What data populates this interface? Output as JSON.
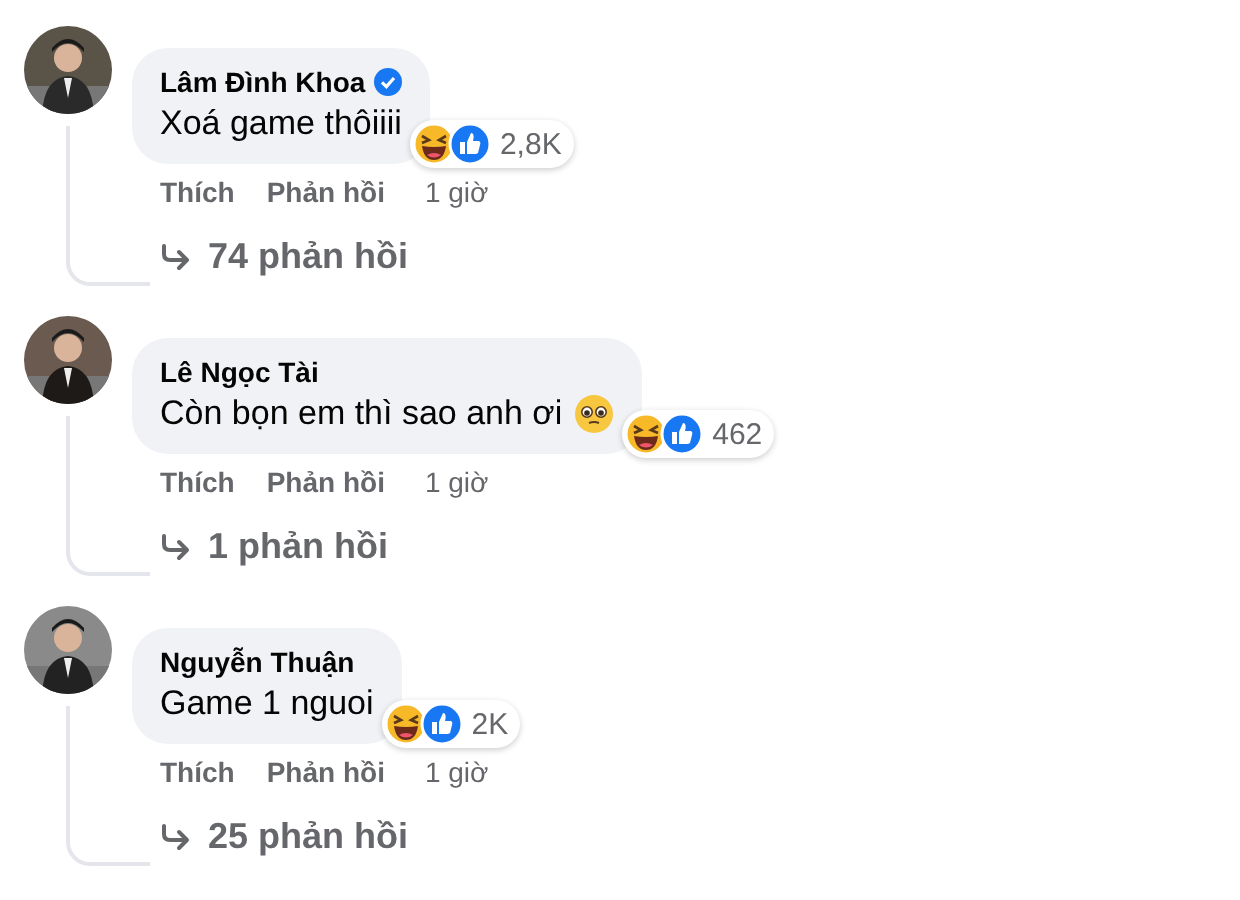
{
  "comments": [
    {
      "author": "Lâm Đình Khoa",
      "verified": true,
      "text": "Xoá game thôiiii",
      "has_emoji": false,
      "reaction_count": "2,8K",
      "actions": [
        "Thích",
        "Phản hồi"
      ],
      "time": "1 giờ",
      "replies": "74 phản hồi"
    },
    {
      "author": "Lê Ngọc Tài",
      "verified": false,
      "text": "Còn bọn em thì sao anh ơi",
      "has_emoji": true,
      "reaction_count": "462",
      "actions": [
        "Thích",
        "Phản hồi"
      ],
      "time": "1 giờ",
      "replies": "1 phản hồi"
    },
    {
      "author": "Nguyễn Thuận",
      "verified": false,
      "text": "Game 1 nguoi",
      "has_emoji": false,
      "reaction_count": "2K",
      "actions": [
        "Thích",
        "Phản hồi"
      ],
      "time": "1 giờ",
      "replies": "25 phản hồi"
    }
  ]
}
